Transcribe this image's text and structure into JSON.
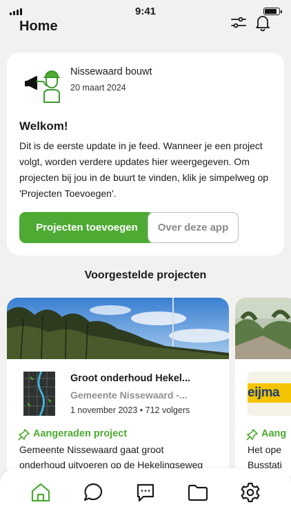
{
  "status_bar": {
    "time": "9:41"
  },
  "header": {
    "title": "Home"
  },
  "welcome_card": {
    "author": "Nissewaard bouwt",
    "date": "20 maart 2024",
    "heading": "Welkom!",
    "body": "Dit is de eerste update in je feed. Wanneer je een project volgt, worden verdere updates hier weergegeven. Om projecten bij jou in de buurt te vinden, klik je simpelweg op 'Projecten Toevoegen'.",
    "primary_button": "Projecten toevoegen",
    "secondary_button": "Over deze app"
  },
  "suggested": {
    "title": "Voorgestelde projecten",
    "projects": [
      {
        "title": "Groot onderhoud Hekel...",
        "organization": "Gemeente Nissewaard -...",
        "meta": "1 november 2023 • 712 volgers",
        "badge": "Aangeraden project",
        "description": "Gemeente Nissewaard gaat groot",
        "description2": "onderhoud uitvoeren op de Hekelingseweg"
      },
      {
        "logo_text": "eijma",
        "badge": "Aang",
        "description": "Het ope",
        "description2": "Busstati"
      }
    ]
  },
  "accent_color": "#4daa32",
  "bottom_nav": {
    "items": [
      "home-icon",
      "chat-icon",
      "messages-icon",
      "folder-icon",
      "settings-icon"
    ],
    "active": "home-icon"
  }
}
